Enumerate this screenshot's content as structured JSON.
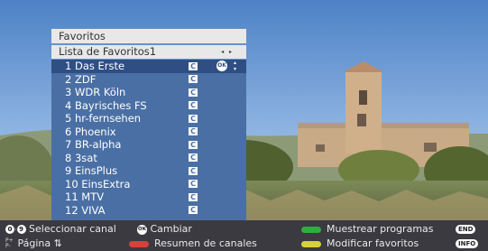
{
  "panel": {
    "title": "Favoritos",
    "list_name": "Lista de Favoritos1",
    "list_arrows": "◂ ▸",
    "channels": [
      {
        "label": "1 Das Erste"
      },
      {
        "label": "2 ZDF"
      },
      {
        "label": "3 WDR Köln"
      },
      {
        "label": "4 Bayrisches FS"
      },
      {
        "label": "5 hr-fernsehen"
      },
      {
        "label": "6 Phoenix"
      },
      {
        "label": "7 BR-alpha"
      },
      {
        "label": "8 3sat"
      },
      {
        "label": "9 EinsPlus"
      },
      {
        "label": "10 EinsExtra"
      },
      {
        "label": "11 MTV"
      },
      {
        "label": "12 VIVA"
      }
    ],
    "selected_index": 0,
    "c_badge": "C",
    "ok_badge": "OK",
    "updown": "▴\n▾"
  },
  "legend": {
    "key_0": "0",
    "key_9": "9",
    "select_channel": "Seleccionar canal",
    "ok_key": "OK",
    "change": "Cambiar",
    "page_icon": "P+ P-",
    "page": "Página ⇅",
    "overview": "Resumen de canales",
    "preview": "Muestrear programas",
    "edit_favorites": "Modificar favoritos",
    "end_key": "END",
    "info_key": "INFO"
  },
  "colors": {
    "red": "#d8403a",
    "green": "#2fae3c",
    "yellow": "#d8d03a",
    "list_bg": "#4a6fa4",
    "list_selected": "#2f4f84"
  }
}
